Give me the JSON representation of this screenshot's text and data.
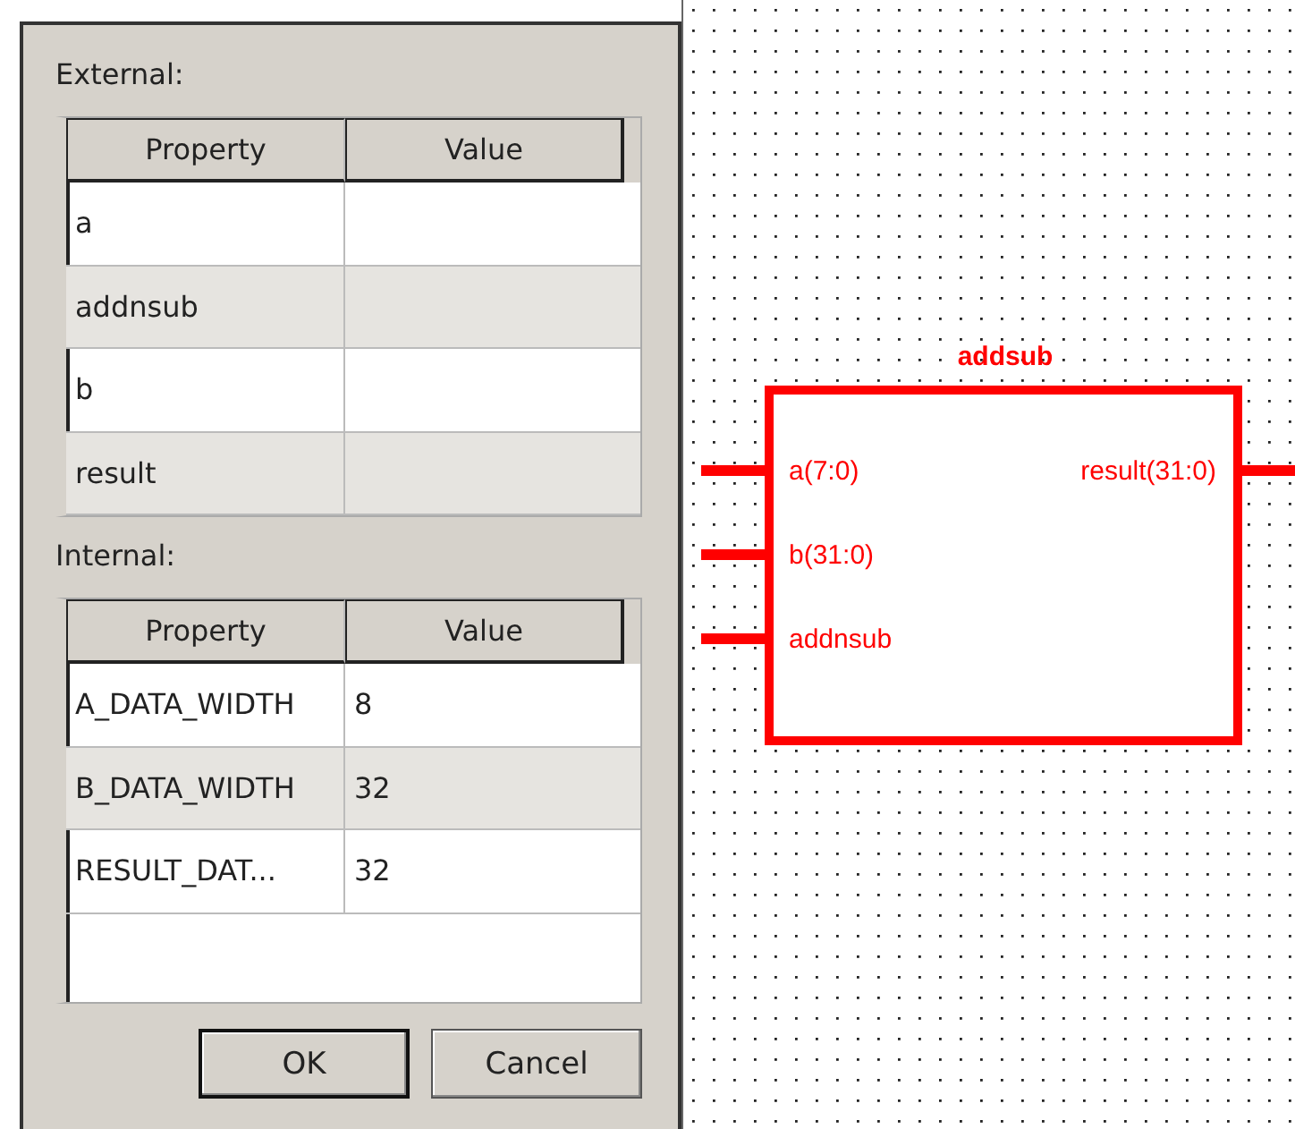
{
  "dialog": {
    "sections": [
      {
        "label": "External:",
        "columns": [
          "Property",
          "Value"
        ],
        "rows": [
          {
            "property": "a",
            "value": ""
          },
          {
            "property": "addnsub",
            "value": ""
          },
          {
            "property": "b",
            "value": ""
          },
          {
            "property": "result",
            "value": ""
          }
        ]
      },
      {
        "label": "Internal:",
        "columns": [
          "Property",
          "Value"
        ],
        "rows": [
          {
            "property": "A_DATA_WIDTH",
            "value": "8"
          },
          {
            "property": "B_DATA_WIDTH",
            "value": "32"
          },
          {
            "property": "RESULT_DAT...",
            "value": "32"
          }
        ]
      }
    ],
    "buttons": [
      "OK",
      "Cancel"
    ]
  },
  "symbol": {
    "title": "addsub",
    "pins": [
      {
        "name": "a(7:0)",
        "kind": "input"
      },
      {
        "name": "b(31:0)",
        "kind": "input"
      },
      {
        "name": "addnsub",
        "kind": "input"
      },
      {
        "name": "result(31:0)",
        "kind": "output"
      }
    ]
  }
}
